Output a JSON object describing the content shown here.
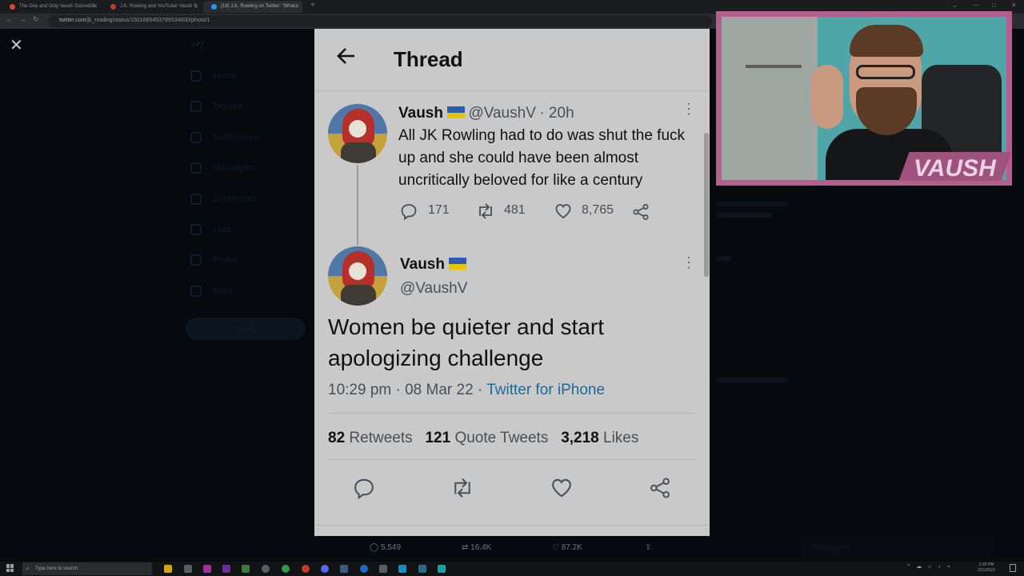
{
  "browser": {
    "tabs": [
      {
        "label": "The One and Only Vaush Subreddit",
        "color": "#d9482b"
      },
      {
        "label": "J.K. Rowling and YouTuber Vaush S",
        "color": "#c0392b"
      },
      {
        "label": "(18) J.K. Rowling on Twitter: \"What i",
        "color": "#1d9bf0"
      }
    ],
    "url_host": "twitter.com",
    "url_path": "/jk_rowling/status/1501685453799534600/photo/1"
  },
  "background": {
    "sidebar": [
      "Home",
      "Explore",
      "Notifications",
      "Messages",
      "Bookmarks",
      "Lists",
      "Profile",
      "More"
    ],
    "sidebar_button": "Tweet",
    "messages_label": "Messages",
    "bottom_actions": {
      "replies": "5,549",
      "retweets": "16.4K",
      "likes": "87.2K"
    }
  },
  "modal": {
    "title": "Thread",
    "tweet1": {
      "name": "Vaush",
      "handle": "@VaushV",
      "time": "· 20h",
      "text": "All JK Rowling had to do was shut the fuck up and she could have been almost uncritically beloved for like a century",
      "replies": "171",
      "retweets": "481",
      "likes": "8,765"
    },
    "tweet2": {
      "name": "Vaush",
      "handle": "@VaushV",
      "text": "Women be quieter and start apologizing challenge",
      "time": "10:29 pm · 08 Mar 22 · ",
      "source": "Twitter for iPhone",
      "retweets_count": "82",
      "retweets_label": "Retweets",
      "quotes_count": "121",
      "quotes_label": "Quote Tweets",
      "likes_count": "3,218",
      "likes_label": "Likes"
    }
  },
  "webcam": {
    "logo": "VAUSH"
  },
  "taskbar": {
    "search_placeholder": "Type here to search",
    "time": "1:39 PM",
    "date": "3/11/2022"
  }
}
